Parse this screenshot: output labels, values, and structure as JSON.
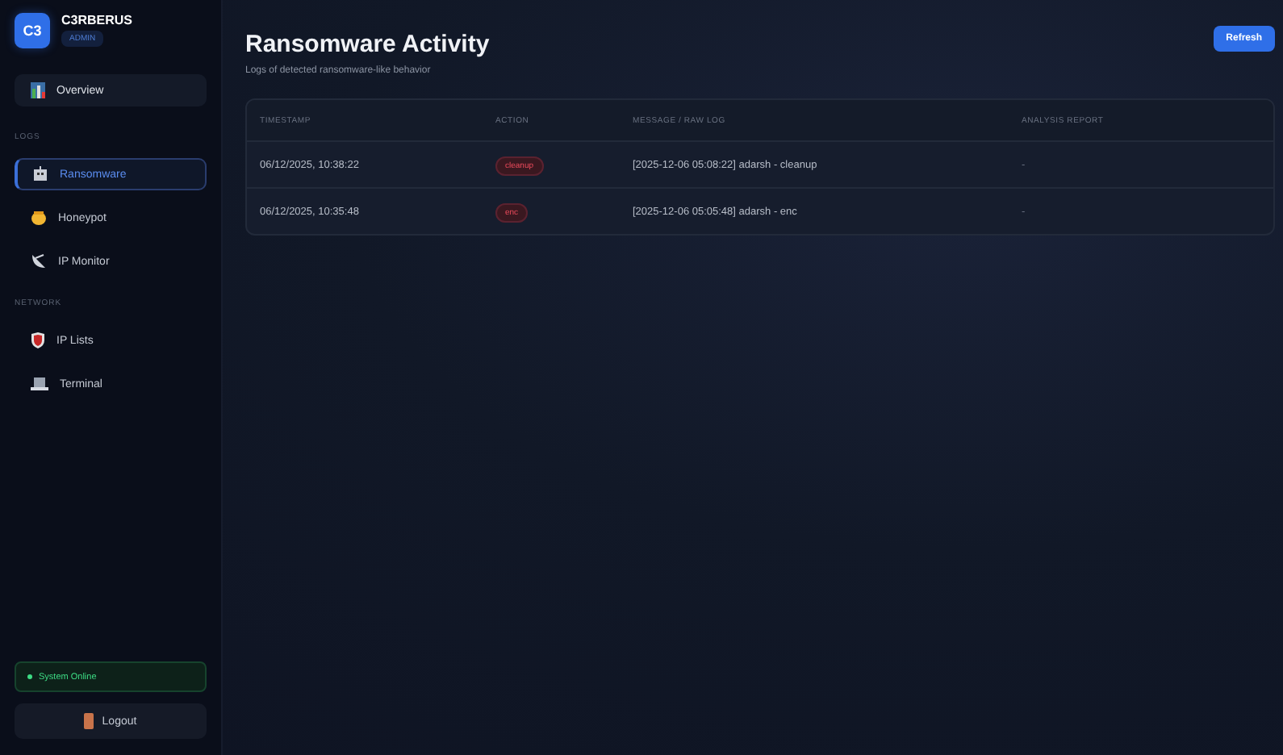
{
  "brand": {
    "logo": "C3",
    "name": "C3RBERUS",
    "role": "ADMIN"
  },
  "nav": [
    {
      "label": "Overview",
      "selected": false
    },
    {
      "heading": "LOGS",
      "items": [
        {
          "label": "Ransomware",
          "selected": true
        },
        {
          "label": "Honeypot",
          "selected": false
        },
        {
          "label": "IP Monitor",
          "selected": false
        }
      ]
    },
    {
      "heading": "NETWORK",
      "items": [
        {
          "label": "IP Lists",
          "selected": false
        },
        {
          "label": "Terminal",
          "selected": false
        }
      ]
    }
  ],
  "status": {
    "label": "System Online",
    "online": true
  },
  "logout": "Logout",
  "page": {
    "title": "Ransomware Activity",
    "subtitle": "Logs of detected ransomware-like behavior",
    "refresh": "Refresh"
  },
  "table": {
    "columns": [
      "TIMESTAMP",
      "ACTION",
      "MESSAGE / RAW LOG",
      "ANALYSIS REPORT"
    ],
    "rows": [
      {
        "timestamp": "06/12/2025, 10:38:22",
        "action": "cleanup",
        "message": "[2025-12-06 05:08:22] adarsh - cleanup",
        "report": "-"
      },
      {
        "timestamp": "06/12/2025, 10:35:48",
        "action": "enc",
        "message": "[2025-12-06 05:05:48] adarsh - enc",
        "report": "-"
      }
    ]
  }
}
